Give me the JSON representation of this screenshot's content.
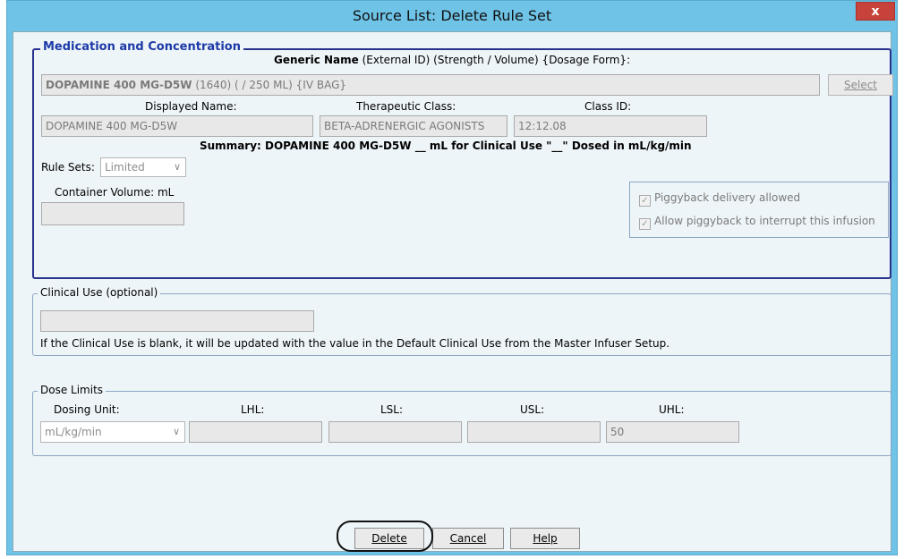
{
  "window": {
    "title": "Source List:  Delete Rule Set",
    "close_label": "x"
  },
  "medication": {
    "legend": "Medication and Concentration",
    "header": {
      "generic_name": "Generic Name",
      "rest": "(External ID)  (Strength / Volume)  {Dosage Form}:"
    },
    "generic_value": {
      "name": "DOPAMINE 400 MG-D5W",
      "rest": " (1640) ( / 250 ML) {IV BAG}"
    },
    "select_label": "Select",
    "displayed_name_label": "Displayed Name:",
    "displayed_name_value": "DOPAMINE 400 MG-D5W",
    "therapeutic_class_label": "Therapeutic Class:",
    "therapeutic_class_value": "BETA-ADRENERGIC AGONISTS",
    "class_id_label": "Class ID:",
    "class_id_value": "12:12.08",
    "summary": "Summary: DOPAMINE 400 MG-D5W __ mL for Clinical Use \"__\" Dosed in mL/kg/min",
    "rule_sets_label": "Rule Sets:",
    "rule_sets_value": "Limited",
    "container_volume_label": "Container Volume: mL",
    "container_volume_value": "",
    "piggyback_allowed": "Piggyback delivery allowed",
    "piggyback_interrupt": "Allow piggyback to interrupt this infusion"
  },
  "clinical_use": {
    "legend": "Clinical Use (optional)",
    "value": "",
    "note": "If the Clinical Use is blank, it will be updated with the value in the Default Clinical Use from the Master Infuser Setup."
  },
  "dose_limits": {
    "legend": "Dose Limits",
    "dosing_unit_label": "Dosing Unit:",
    "dosing_unit_value": "mL/kg/min",
    "lhl_label": "LHL:",
    "lsl_label": "LSL:",
    "usl_label": "USL:",
    "uhl_label": "UHL:",
    "lhl_value": "",
    "lsl_value": "",
    "usl_value": "",
    "uhl_value": "50"
  },
  "buttons": {
    "delete_label": "Delete",
    "cancel_label": "Cancel",
    "help_label": "Help"
  }
}
